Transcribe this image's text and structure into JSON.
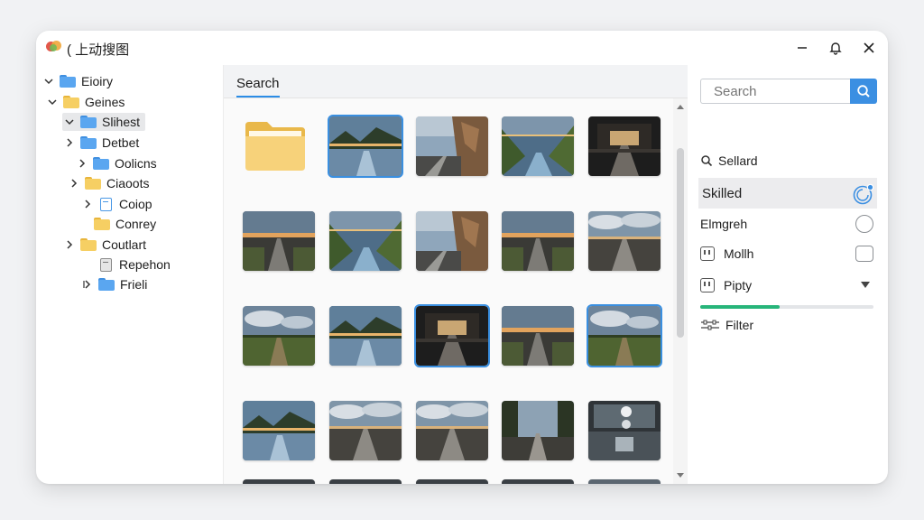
{
  "window": {
    "title": "( 上动搜图",
    "controls": [
      "minimize-icon",
      "bell-icon",
      "close-icon"
    ]
  },
  "tree": {
    "items": [
      {
        "label": "Eioiry",
        "icon": "folder-blue",
        "chevron": "down"
      },
      {
        "label": "Geines",
        "icon": "folder-yellow",
        "chevron": "down"
      },
      {
        "label": "Slihest",
        "icon": "folder-blue",
        "chevron": "down",
        "selected": true
      },
      {
        "label": "Detbet",
        "icon": "folder-blue",
        "chevron": "right"
      },
      {
        "label": "Oolicns",
        "icon": "folder-blue",
        "chevron": "right"
      },
      {
        "label": "Ciaoots",
        "icon": "folder-yellow",
        "chevron": "right"
      },
      {
        "label": "Coiop",
        "icon": "document-blue",
        "chevron": "right"
      },
      {
        "label": "Conrey",
        "icon": "folder-yellow",
        "chevron": "none"
      },
      {
        "label": "Coutlart",
        "icon": "folder-yellow",
        "chevron": "right"
      },
      {
        "label": "Repehon",
        "icon": "document-gray",
        "chevron": "none"
      },
      {
        "label": "Frieli",
        "icon": "folder-blue",
        "chevron": "right"
      }
    ]
  },
  "center": {
    "tab_label": "Search",
    "thumbnails": [
      {
        "kind": "folder-icon",
        "selected": false
      },
      {
        "kind": "lake-mountains",
        "selected": true
      },
      {
        "kind": "rock-road",
        "selected": false
      },
      {
        "kind": "valley-river",
        "selected": false
      },
      {
        "kind": "tunnel",
        "selected": false
      },
      {
        "kind": "road-sunset",
        "selected": false
      },
      {
        "kind": "valley-river",
        "selected": false
      },
      {
        "kind": "rock-road",
        "selected": false
      },
      {
        "kind": "road-sunset",
        "selected": false
      },
      {
        "kind": "road-clouds",
        "selected": false
      },
      {
        "kind": "field-clouds",
        "selected": false
      },
      {
        "kind": "lake-mountains",
        "selected": false
      },
      {
        "kind": "tunnel",
        "selected": true
      },
      {
        "kind": "road-sunset",
        "selected": false
      },
      {
        "kind": "field-clouds",
        "selected": true
      },
      {
        "kind": "lake-mountains",
        "selected": false
      },
      {
        "kind": "road-clouds",
        "selected": false
      },
      {
        "kind": "road-clouds",
        "selected": false
      },
      {
        "kind": "forest-road",
        "selected": false
      },
      {
        "kind": "reflection",
        "selected": false
      }
    ]
  },
  "right": {
    "search_placeholder": "Search",
    "options": [
      {
        "label": "Sellard",
        "icon": "search-icon"
      },
      {
        "label": "Skilled",
        "control": "radio-selected"
      },
      {
        "label": "Elmgreh",
        "control": "radio"
      },
      {
        "label": "Mollh",
        "icon": "plug-icon",
        "control": "checkbox"
      },
      {
        "label": "Pipty",
        "icon": "plug-icon",
        "control": "dropdown"
      }
    ],
    "progress": 0.46,
    "filter_label": "Filter",
    "accent": "#3b8fe2",
    "progress_color": "#27b57a"
  }
}
